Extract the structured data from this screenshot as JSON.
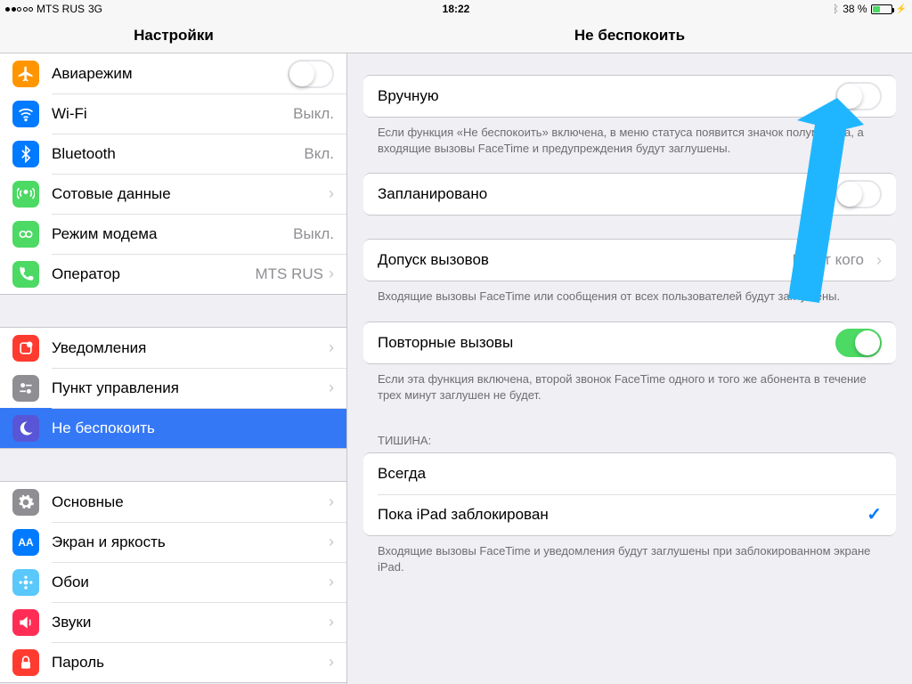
{
  "statusbar": {
    "carrier": "MTS RUS",
    "network": "3G",
    "time": "18:22",
    "battery_pct": "38 %",
    "charging": "⚡"
  },
  "header": {
    "left": "Настройки",
    "right": "Не беспокоить"
  },
  "sidebar": {
    "g1": [
      {
        "label": "Авиарежим",
        "icon_bg": "#ff9500",
        "icon": "airplane",
        "switch": false
      },
      {
        "label": "Wi-Fi",
        "icon_bg": "#007aff",
        "icon": "wifi",
        "value": "Выкл."
      },
      {
        "label": "Bluetooth",
        "icon_bg": "#007aff",
        "icon": "bluetooth",
        "value": "Вкл."
      },
      {
        "label": "Сотовые данные",
        "icon_bg": "#4cd964",
        "icon": "antenna",
        "value": ""
      },
      {
        "label": "Режим модема",
        "icon_bg": "#4cd964",
        "icon": "hotspot",
        "value": "Выкл."
      },
      {
        "label": "Оператор",
        "icon_bg": "#4cd964",
        "icon": "phone",
        "value": "MTS RUS"
      }
    ],
    "g2": [
      {
        "label": "Уведомления",
        "icon_bg": "#ff3b30",
        "icon": "bell"
      },
      {
        "label": "Пункт управления",
        "icon_bg": "#8e8e93",
        "icon": "sliders"
      },
      {
        "label": "Не беспокоить",
        "icon_bg": "#5856d6",
        "icon": "moon",
        "selected": true
      }
    ],
    "g3": [
      {
        "label": "Основные",
        "icon_bg": "#8e8e93",
        "icon": "gear"
      },
      {
        "label": "Экран и яркость",
        "icon_bg": "#007aff",
        "icon": "text"
      },
      {
        "label": "Обои",
        "icon_bg": "#5ac8fa",
        "icon": "flower"
      },
      {
        "label": "Звуки",
        "icon_bg": "#ff2d55",
        "icon": "sound"
      },
      {
        "label": "Пароль",
        "icon_bg": "#ff3b30",
        "icon": "lock"
      }
    ]
  },
  "detail": {
    "manual": {
      "label": "Вручную",
      "on": false
    },
    "manual_footer": "Если функция «Не беспокоить» включена, в меню статуса появится значок полумесяца, а входящие вызовы FaceTime и предупреждения будут заглушены.",
    "scheduled": {
      "label": "Запланировано",
      "on": false
    },
    "allow_calls": {
      "label": "Допуск вызовов",
      "value": "Ни от кого"
    },
    "allow_calls_footer": "Входящие вызовы FaceTime или сообщения от всех пользователей будут заглушены.",
    "repeated": {
      "label": "Повторные вызовы",
      "on": true
    },
    "repeated_footer": "Если эта функция включена, второй звонок FaceTime одного и того же абонента в течение трех минут заглушен не будет.",
    "silence_header": "ТИШИНА:",
    "silence_always": "Всегда",
    "silence_locked": "Пока iPad заблокирован",
    "silence_footer": "Входящие вызовы FaceTime и уведомления будут заглушены при заблокированном экране iPad."
  }
}
